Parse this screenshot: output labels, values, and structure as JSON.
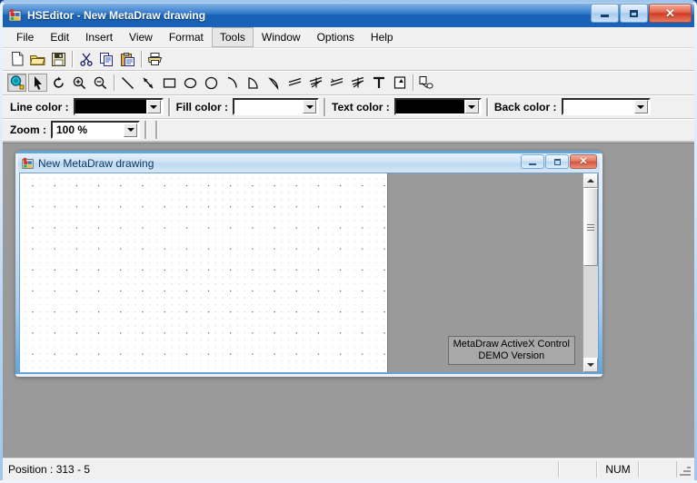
{
  "window": {
    "title": "HSEditor - New MetaDraw drawing",
    "icon": "app-icon",
    "buttons": {
      "minimize": "minimize-button",
      "maximize": "maximize-button",
      "close": "close-button"
    }
  },
  "menubar": {
    "items": [
      {
        "label": "File",
        "active": false
      },
      {
        "label": "Edit",
        "active": false
      },
      {
        "label": "Insert",
        "active": false
      },
      {
        "label": "View",
        "active": false
      },
      {
        "label": "Format",
        "active": false
      },
      {
        "label": "Tools",
        "active": true
      },
      {
        "label": "Window",
        "active": false
      },
      {
        "label": "Options",
        "active": false
      },
      {
        "label": "Help",
        "active": false
      }
    ]
  },
  "toolbar_standard": {
    "buttons": [
      {
        "name": "new-file-icon",
        "tip": "New"
      },
      {
        "name": "open-folder-icon",
        "tip": "Open"
      },
      {
        "name": "save-disk-icon",
        "tip": "Save"
      },
      {
        "name": "cut-scissors-icon",
        "tip": "Cut"
      },
      {
        "name": "copy-icon",
        "tip": "Copy"
      },
      {
        "name": "paste-clipboard-icon",
        "tip": "Paste"
      },
      {
        "name": "print-icon",
        "tip": "Print"
      }
    ]
  },
  "toolbar_draw": {
    "buttons": [
      {
        "name": "zoom-hotspot-icon",
        "tip": "Hotspot",
        "pressed": true
      },
      {
        "name": "select-arrow-icon",
        "tip": "Select",
        "pressed": false,
        "sunken": true
      },
      {
        "name": "rotate-icon",
        "tip": "Rotate",
        "pressed": false
      },
      {
        "name": "zoom-in-icon",
        "tip": "Zoom In",
        "pressed": false
      },
      {
        "name": "zoom-out-icon",
        "tip": "Zoom Out",
        "pressed": false
      },
      {
        "name": "line-icon",
        "tip": "Line",
        "pressed": false
      },
      {
        "name": "arrow-line-icon",
        "tip": "Arrow",
        "pressed": false
      },
      {
        "name": "rectangle-icon",
        "tip": "Rectangle",
        "pressed": false
      },
      {
        "name": "ellipse-icon",
        "tip": "Ellipse",
        "pressed": false
      },
      {
        "name": "circle-icon",
        "tip": "Circle",
        "pressed": false
      },
      {
        "name": "arc-icon",
        "tip": "Arc",
        "pressed": false
      },
      {
        "name": "chord-icon",
        "tip": "Chord",
        "pressed": false
      },
      {
        "name": "pie-icon",
        "tip": "Pie",
        "pressed": false
      },
      {
        "name": "polyline-icon",
        "tip": "Polyline",
        "pressed": false
      },
      {
        "name": "polygon-icon",
        "tip": "Polygon",
        "pressed": false
      },
      {
        "name": "curve-icon",
        "tip": "Curve",
        "pressed": false
      },
      {
        "name": "closed-curve-icon",
        "tip": "Closed Curve",
        "pressed": false
      },
      {
        "name": "text-icon",
        "tip": "Text",
        "pressed": false
      },
      {
        "name": "image-box-icon",
        "tip": "Image",
        "pressed": false
      },
      {
        "name": "hotspot-link-icon",
        "tip": "Hyperlink",
        "pressed": false
      }
    ]
  },
  "colorbar": {
    "line_color": {
      "label": "Line color :",
      "value": "#000000"
    },
    "fill_color": {
      "label": "Fill color :",
      "value": "#ffffff"
    },
    "text_color": {
      "label": "Text color :",
      "value": "#000000"
    },
    "back_color": {
      "label": "Back color :",
      "value": "#ffffff"
    }
  },
  "zoombar": {
    "label": "Zoom :",
    "value": "100 %"
  },
  "child_window": {
    "title": "New MetaDraw drawing",
    "icon": "document-icon",
    "buttons": {
      "minimize": "child-minimize-button",
      "restore": "child-restore-button",
      "close": "child-close-button"
    },
    "watermark": {
      "line1": "MetaDraw ActiveX Control",
      "line2": "DEMO Version"
    }
  },
  "statusbar": {
    "position": "Position : 313 - 5",
    "num_lock": "NUM"
  }
}
